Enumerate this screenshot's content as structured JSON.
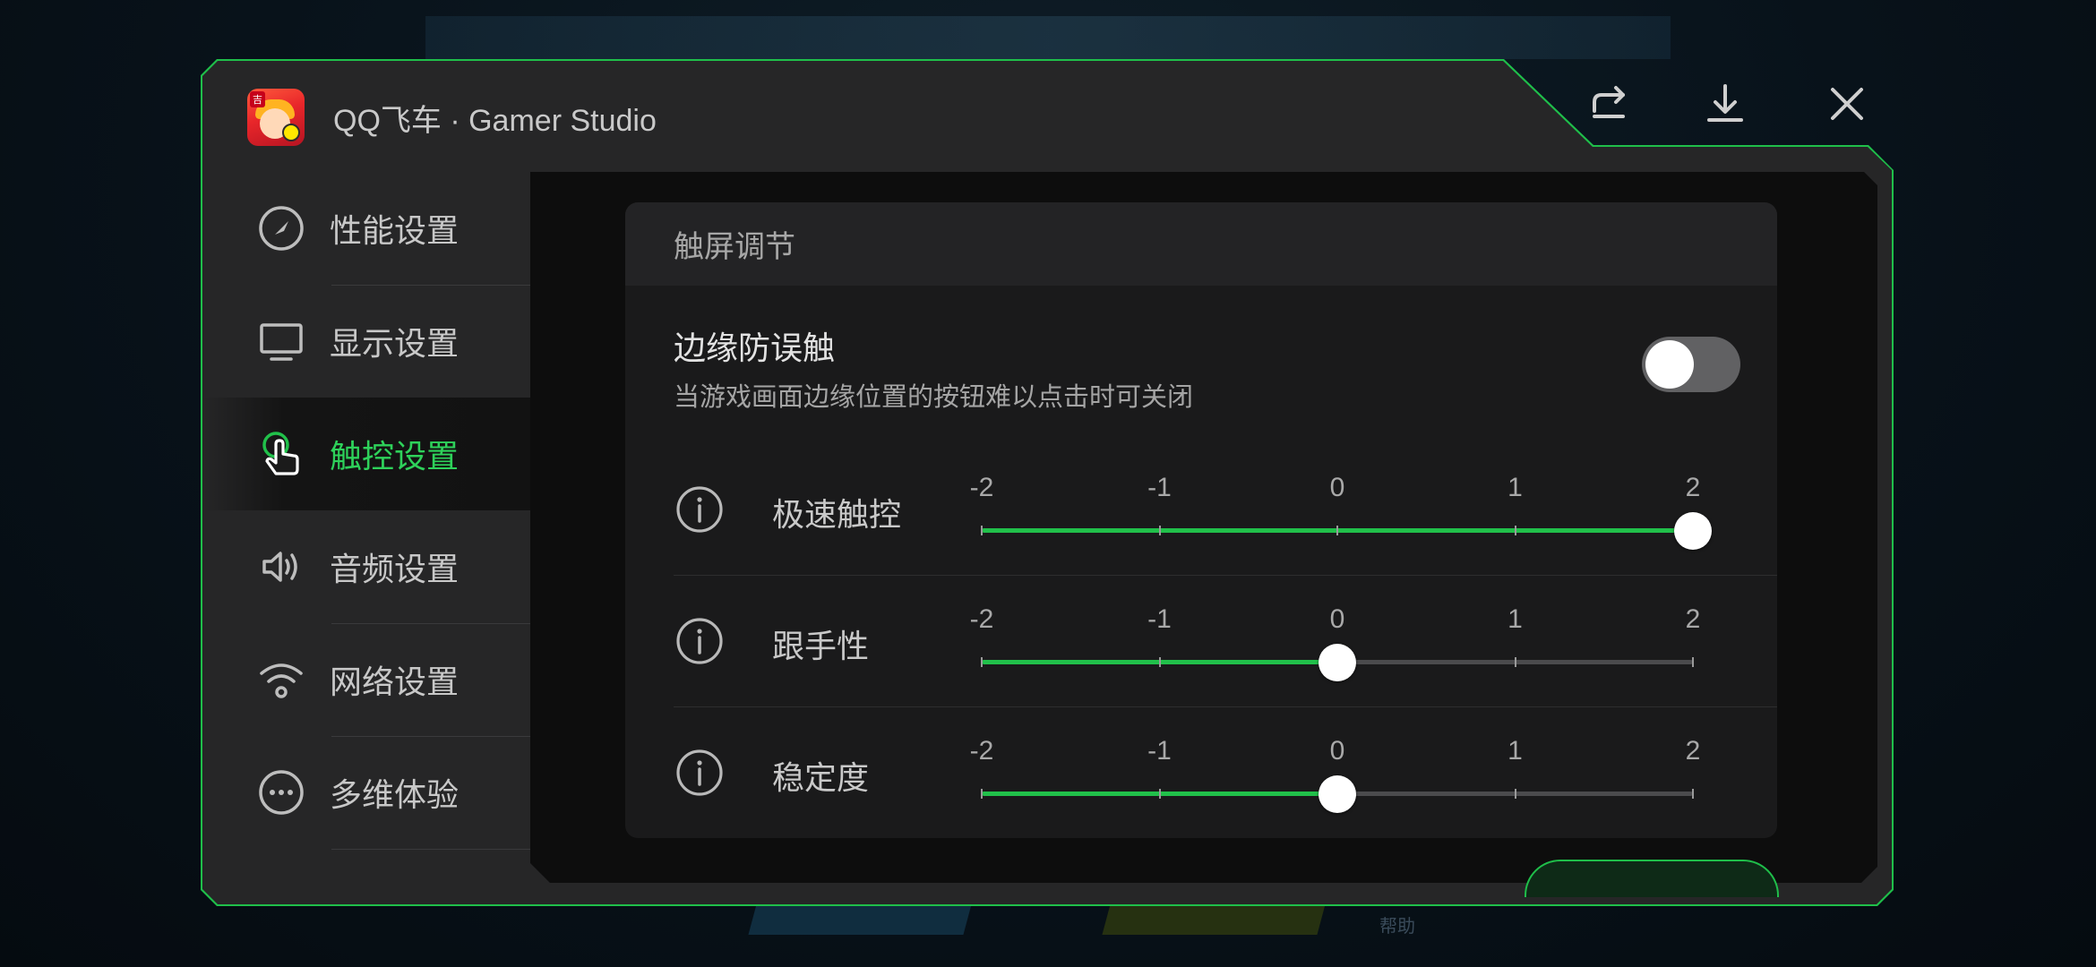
{
  "background": {
    "help_text": "帮助"
  },
  "window": {
    "title": "QQ飞车 · Gamer Studio",
    "accent_color": "#1fbf4a",
    "app_icon": "qq-speed-app-icon",
    "titlebar_buttons": [
      {
        "icon": "share-icon"
      },
      {
        "icon": "download-icon"
      },
      {
        "icon": "close-icon"
      }
    ]
  },
  "sidebar": {
    "items": [
      {
        "label": "性能设置",
        "icon": "speedometer-icon",
        "active": false
      },
      {
        "label": "显示设置",
        "icon": "monitor-icon",
        "active": false
      },
      {
        "label": "触控设置",
        "icon": "touch-hand-icon",
        "active": true
      },
      {
        "label": "音频设置",
        "icon": "speaker-icon",
        "active": false
      },
      {
        "label": "网络设置",
        "icon": "wifi-icon",
        "active": false
      },
      {
        "label": "多维体验",
        "icon": "more-dots-icon",
        "active": false
      }
    ]
  },
  "card": {
    "header": "触屏调节",
    "edge_protection": {
      "title": "边缘防误触",
      "description": "当游戏画面边缘位置的按钮难以点击时可关闭",
      "enabled": false
    },
    "sliders": [
      {
        "label": "极速触控",
        "ticks": [
          "-2",
          "-1",
          "0",
          "1",
          "2"
        ],
        "value": 2,
        "min": -2,
        "max": 2
      },
      {
        "label": "跟手性",
        "ticks": [
          "-2",
          "-1",
          "0",
          "1",
          "2"
        ],
        "value": 0,
        "min": -2,
        "max": 2
      },
      {
        "label": "稳定度",
        "ticks": [
          "-2",
          "-1",
          "0",
          "1",
          "2"
        ],
        "value": 0,
        "min": -2,
        "max": 2
      }
    ]
  }
}
